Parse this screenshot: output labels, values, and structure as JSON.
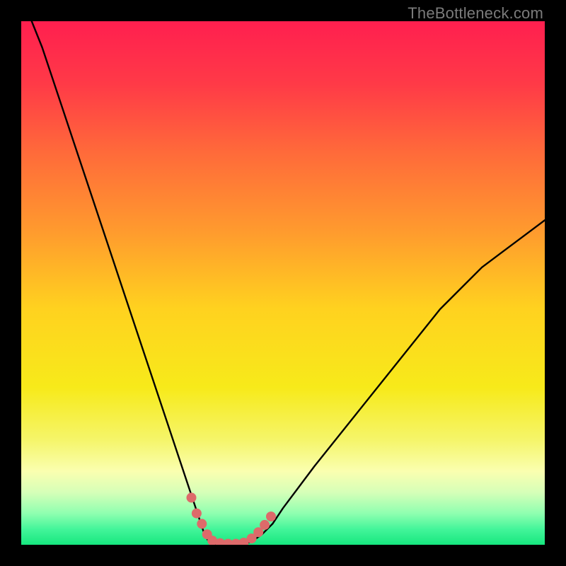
{
  "watermark": {
    "text": "TheBottleneck.com"
  },
  "colors": {
    "frame": "#000000",
    "curve": "#000000",
    "marker": "#dd6a6a",
    "gradient_stops": [
      {
        "offset": 0.0,
        "color": "#ff1f4f"
      },
      {
        "offset": 0.12,
        "color": "#ff3a47"
      },
      {
        "offset": 0.25,
        "color": "#ff6a3a"
      },
      {
        "offset": 0.4,
        "color": "#ff9a2e"
      },
      {
        "offset": 0.55,
        "color": "#ffd21f"
      },
      {
        "offset": 0.7,
        "color": "#f7ea1a"
      },
      {
        "offset": 0.8,
        "color": "#f5f56a"
      },
      {
        "offset": 0.86,
        "color": "#faffb0"
      },
      {
        "offset": 0.9,
        "color": "#d6ffb8"
      },
      {
        "offset": 0.94,
        "color": "#8fffb0"
      },
      {
        "offset": 0.97,
        "color": "#44f59a"
      },
      {
        "offset": 1.0,
        "color": "#16e77f"
      }
    ]
  },
  "chart_data": {
    "type": "line",
    "title": "",
    "xlabel": "",
    "ylabel": "",
    "xlim": [
      0,
      100
    ],
    "ylim": [
      0,
      100
    ],
    "grid": false,
    "series": [
      {
        "name": "bottleneck-curve",
        "x": [
          2,
          4,
          6,
          8,
          10,
          12,
          14,
          16,
          18,
          20,
          22,
          24,
          26,
          28,
          30,
          32,
          33,
          34,
          35,
          36,
          37,
          38,
          40,
          42,
          44,
          46,
          48,
          50,
          53,
          56,
          60,
          64,
          68,
          72,
          76,
          80,
          84,
          88,
          92,
          96,
          100
        ],
        "y": [
          100,
          95,
          89,
          83,
          77,
          71,
          65,
          59,
          53,
          47,
          41,
          35,
          29,
          23,
          17,
          11,
          8,
          5,
          2,
          0.3,
          0,
          0,
          0,
          0,
          0.6,
          2,
          4,
          7,
          11,
          15,
          20,
          25,
          30,
          35,
          40,
          45,
          49,
          53,
          56,
          59,
          62
        ]
      }
    ],
    "markers": {
      "name": "sweet-spot-dots",
      "x": [
        32.5,
        33.5,
        34.5,
        35.5,
        36.5,
        38,
        39.5,
        41,
        42.5,
        44,
        45.3,
        46.5,
        47.7
      ],
      "y": [
        9,
        6,
        4,
        2,
        0.8,
        0.3,
        0.2,
        0.2,
        0.4,
        1.2,
        2.4,
        3.8,
        5.4
      ]
    }
  }
}
